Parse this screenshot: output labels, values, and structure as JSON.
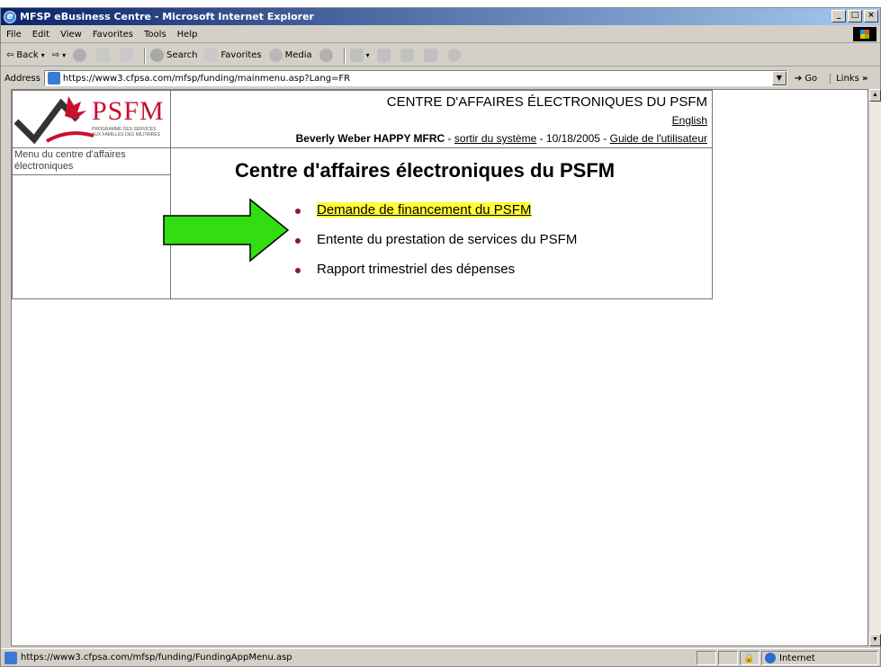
{
  "window": {
    "title": "MFSP eBusiness Centre - Microsoft Internet Explorer"
  },
  "menubar": {
    "items": [
      "File",
      "Edit",
      "View",
      "Favorites",
      "Tools",
      "Help"
    ]
  },
  "toolbar": {
    "back": "Back",
    "search": "Search",
    "favorites": "Favorites",
    "media": "Media"
  },
  "addressbar": {
    "label": "Address",
    "url": "https://www3.cfpsa.com/mfsp/funding/mainmenu.asp?Lang=FR",
    "go": "Go",
    "links": "Links"
  },
  "page": {
    "logo": {
      "name": "PSFM",
      "subtitle_line1": "PROGRAMME DES SERVICES",
      "subtitle_line2": "AUX FAMILLES DES MILITAIRES"
    },
    "header": {
      "title": "CENTRE D'AFFAIRES ÉLECTRONIQUES DU PSFM",
      "english_link": "English",
      "user": "Beverly Weber HAPPY MFRC",
      "sep1": " - ",
      "logout": "sortir du système",
      "date_sep": " - 10/18/2005 - ",
      "guide": "Guide de l'utilisateur"
    },
    "nav": {
      "heading": "Menu du centre d'affaires électroniques"
    },
    "main": {
      "title": "Centre d'affaires électroniques du PSFM",
      "items": [
        "Demande de financement du PSFM",
        "Entente du prestation de services du PSFM",
        "Rapport trimestriel des dépenses"
      ]
    }
  },
  "statusbar": {
    "url": "https://www3.cfpsa.com/mfsp/funding/FundingAppMenu.asp",
    "zone": "Internet"
  }
}
